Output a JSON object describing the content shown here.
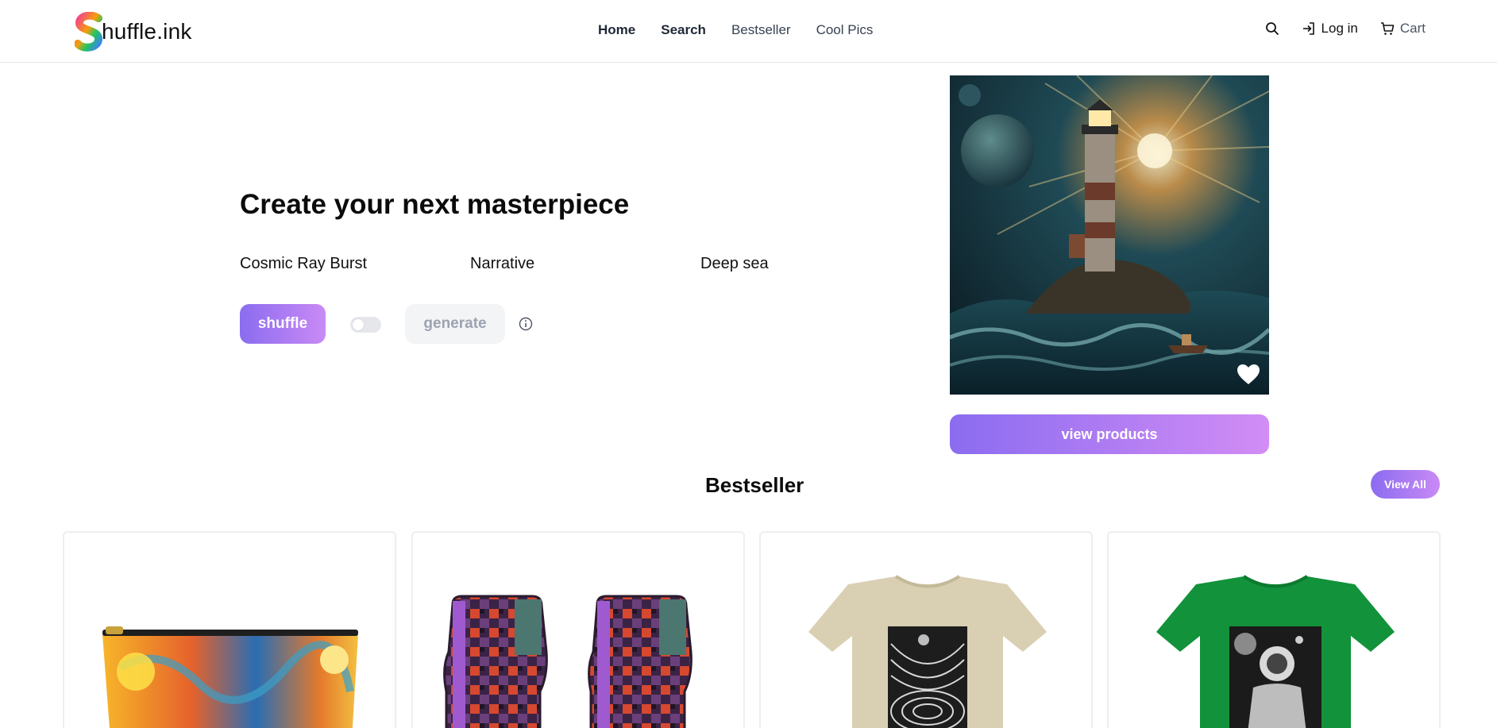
{
  "brand": {
    "name": "huffle.ink",
    "logo_letter": "S"
  },
  "nav": {
    "home": "Home",
    "search": "Search",
    "bestseller": "Bestseller",
    "cool_pics": "Cool Pics"
  },
  "header_actions": {
    "login": "Log in",
    "cart": "Cart"
  },
  "hero": {
    "title": "Create your next masterpiece",
    "keywords": [
      "Cosmic Ray Burst",
      "Narrative",
      "Deep sea"
    ],
    "shuffle_label": "shuffle",
    "generate_label": "generate",
    "toggle_on": false
  },
  "artwork": {
    "view_products_label": "view products",
    "favorited": false
  },
  "bestseller": {
    "title": "Bestseller",
    "view_all_label": "View All",
    "products": [
      {
        "type": "accessory pouch"
      },
      {
        "type": "car floor mats"
      },
      {
        "type": "t-shirt",
        "color": "#d9cfb3"
      },
      {
        "type": "t-shirt",
        "color": "#12923a"
      }
    ]
  },
  "colors": {
    "accent_start": "#8b6cf0",
    "accent_end": "#c98af5",
    "border": "#e5e7eb"
  }
}
